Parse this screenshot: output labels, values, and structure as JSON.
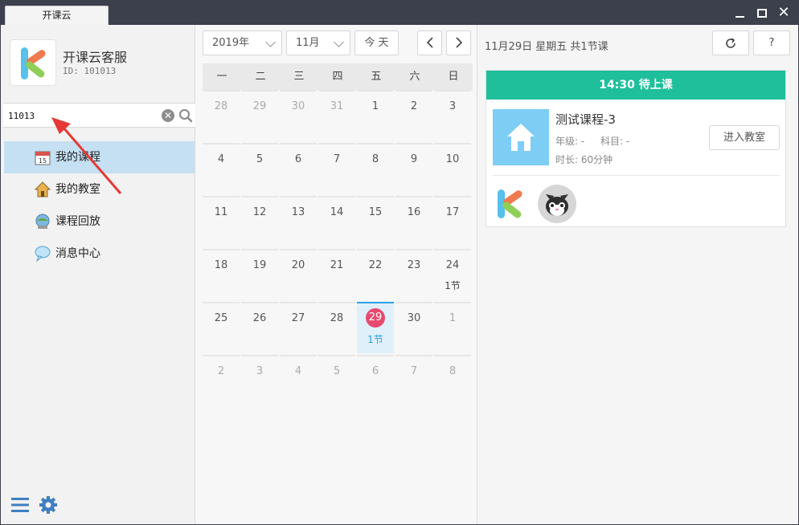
{
  "window": {
    "tab_title": "开课云"
  },
  "sidebar": {
    "app_name": "开课云客服",
    "app_id": "ID: 101013",
    "search_value": "11013",
    "items": [
      {
        "label": "我的课程",
        "icon": "calendar-icon",
        "active": true
      },
      {
        "label": "我的教室",
        "icon": "house-icon",
        "active": false
      },
      {
        "label": "课程回放",
        "icon": "replay-icon",
        "active": false
      },
      {
        "label": "消息中心",
        "icon": "chat-bubble-icon",
        "active": false
      }
    ]
  },
  "calendar": {
    "year_label": "2019年",
    "month_label": "11月",
    "today_label": "今 天",
    "weekdays": [
      "一",
      "二",
      "三",
      "四",
      "五",
      "六",
      "日"
    ],
    "weeks": [
      [
        {
          "d": "28",
          "o": true
        },
        {
          "d": "29",
          "o": true
        },
        {
          "d": "30",
          "o": true
        },
        {
          "d": "31",
          "o": true
        },
        {
          "d": "1"
        },
        {
          "d": "2"
        },
        {
          "d": "3"
        }
      ],
      [
        {
          "d": "4"
        },
        {
          "d": "5"
        },
        {
          "d": "6"
        },
        {
          "d": "7"
        },
        {
          "d": "8"
        },
        {
          "d": "9"
        },
        {
          "d": "10"
        }
      ],
      [
        {
          "d": "11"
        },
        {
          "d": "12"
        },
        {
          "d": "13"
        },
        {
          "d": "14"
        },
        {
          "d": "15"
        },
        {
          "d": "16"
        },
        {
          "d": "17"
        }
      ],
      [
        {
          "d": "18"
        },
        {
          "d": "19"
        },
        {
          "d": "20"
        },
        {
          "d": "21"
        },
        {
          "d": "22"
        },
        {
          "d": "23"
        },
        {
          "d": "24",
          "c": "1节"
        }
      ],
      [
        {
          "d": "25"
        },
        {
          "d": "26"
        },
        {
          "d": "27"
        },
        {
          "d": "28"
        },
        {
          "d": "29",
          "c": "1节",
          "today": true
        },
        {
          "d": "30"
        },
        {
          "d": "1",
          "o": true
        }
      ],
      [
        {
          "d": "2",
          "o": true
        },
        {
          "d": "3",
          "o": true
        },
        {
          "d": "4",
          "o": true
        },
        {
          "d": "5",
          "o": true
        },
        {
          "d": "6",
          "o": true
        },
        {
          "d": "7",
          "o": true
        },
        {
          "d": "8",
          "o": true
        }
      ]
    ]
  },
  "detail": {
    "date_title": "11月29日 星期五 共1节课",
    "refresh_icon": "refresh-icon",
    "help_label": "?",
    "card": {
      "header": "14:30  待上课",
      "course_title": "测试课程-3",
      "grade": "年级: -",
      "subject": "科目: -",
      "duration": "时长: 60分钟",
      "enter_label": "进入教室"
    }
  },
  "colors": {
    "accent_green": "#1fbf9c",
    "today_red": "#e84a6f",
    "active_blue": "#c4e0f2",
    "link_blue": "#2c9fe6"
  }
}
